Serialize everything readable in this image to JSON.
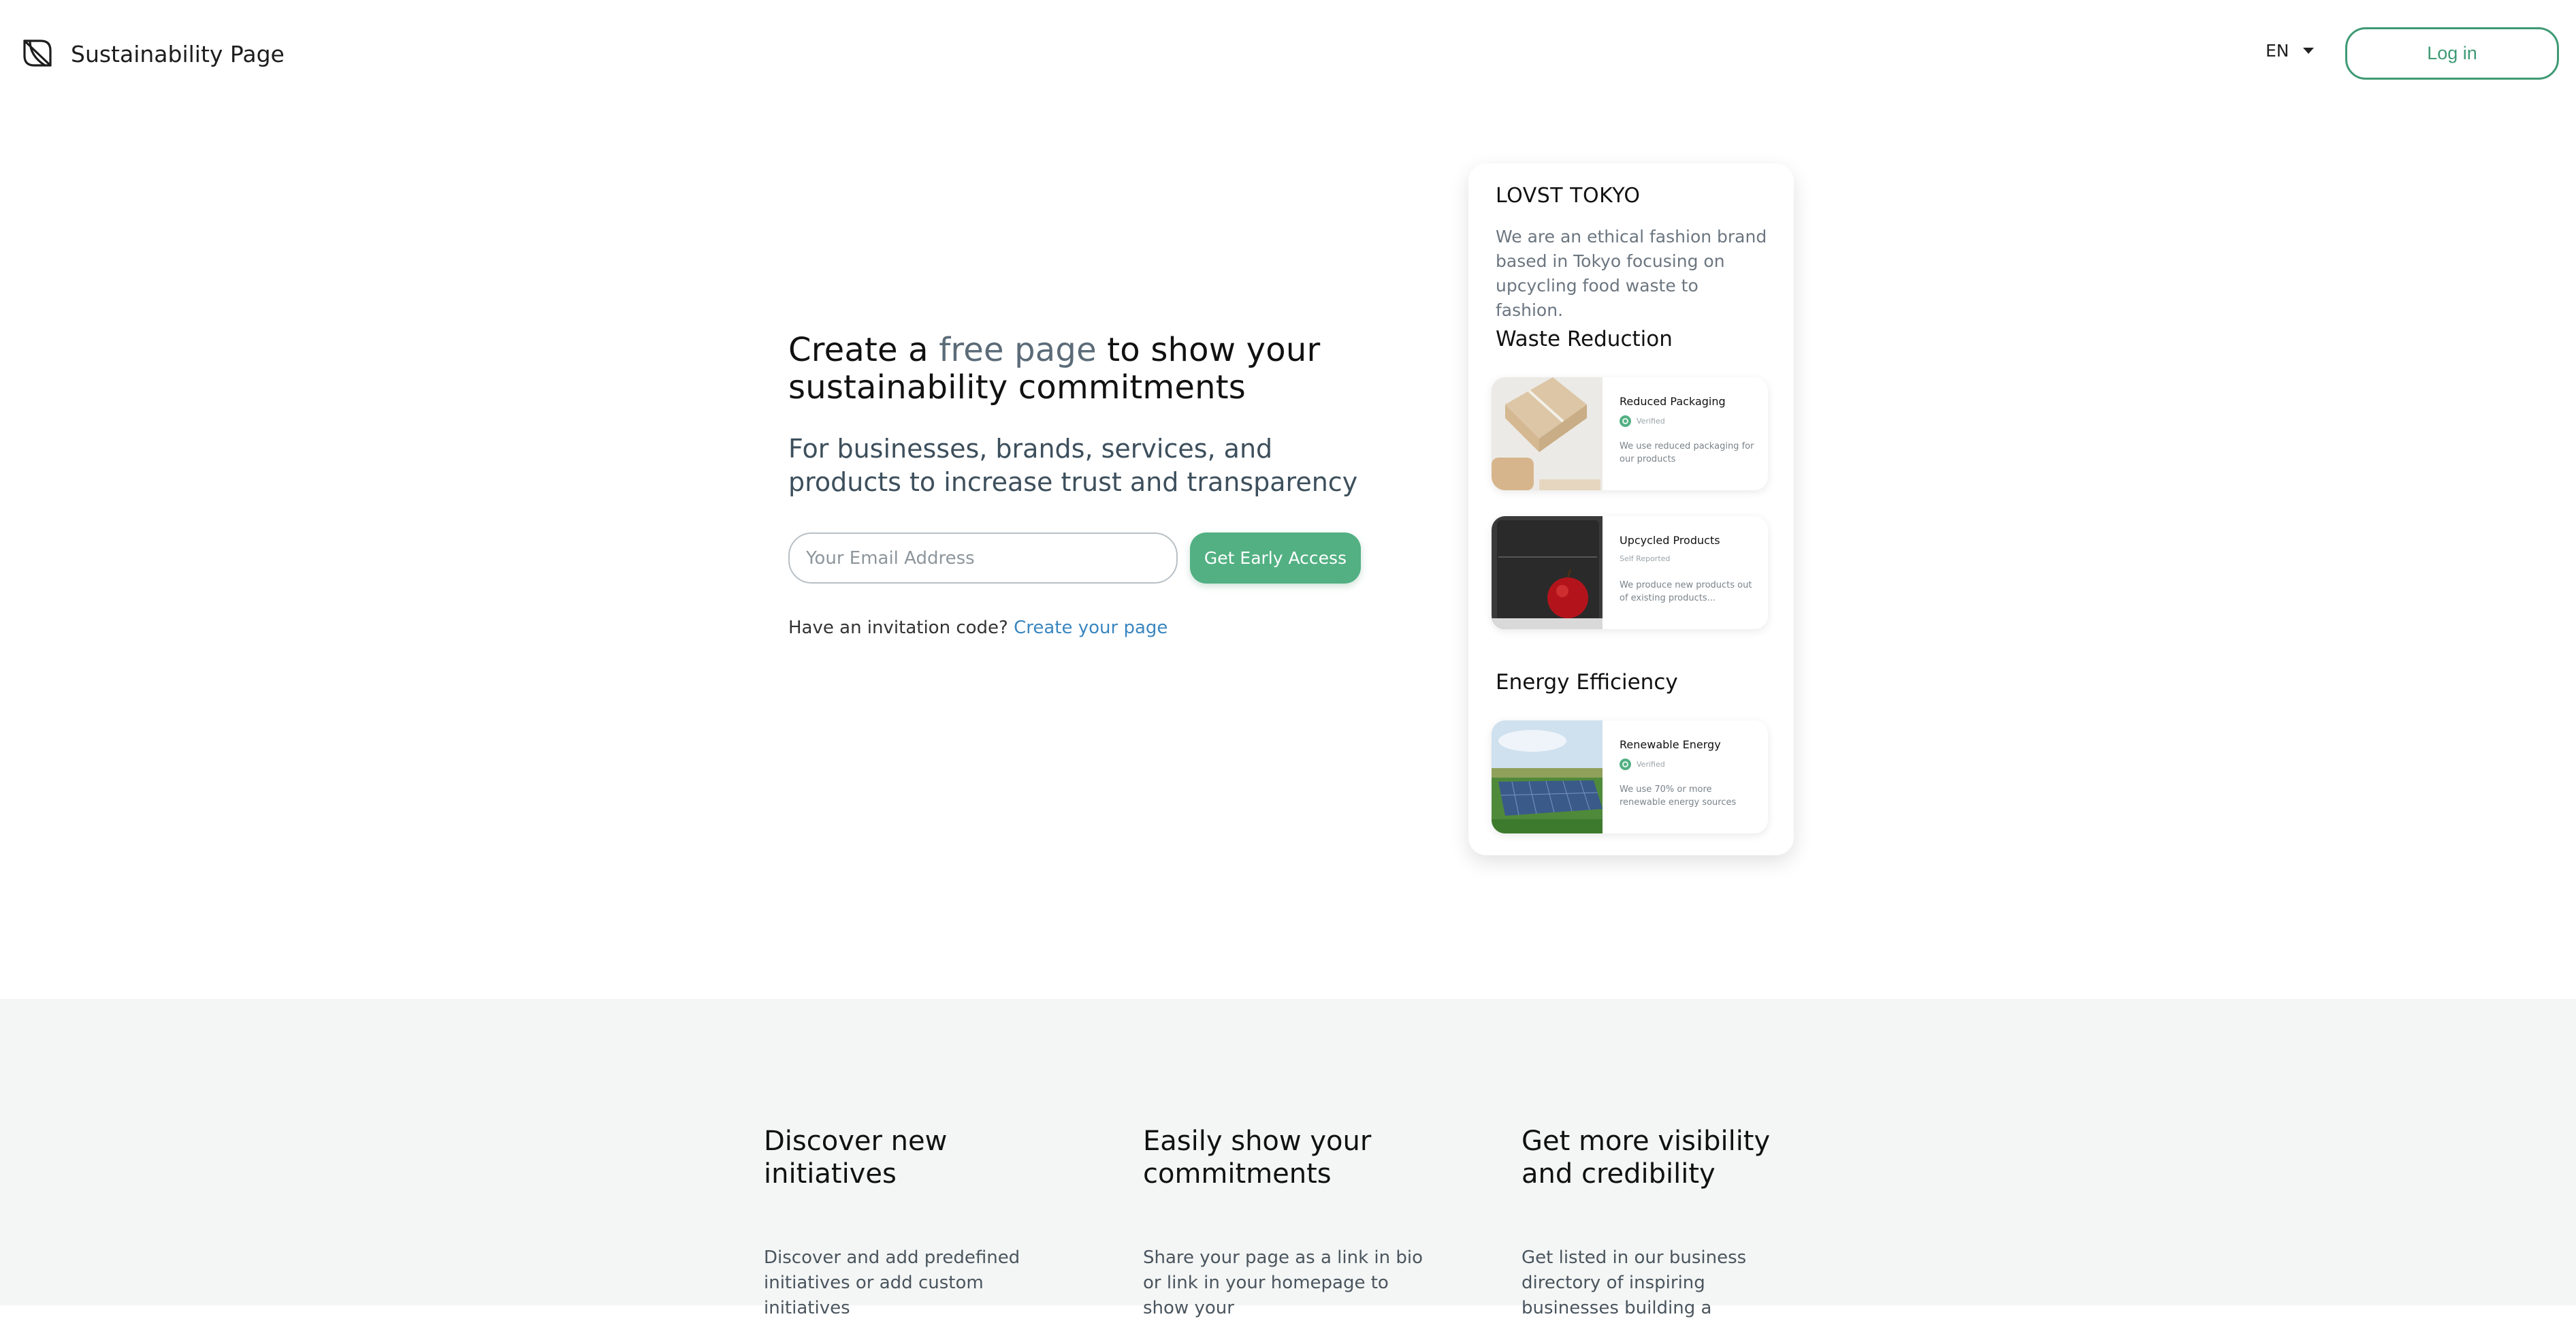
{
  "header": {
    "logo_text": "Sustainability Page",
    "language": "EN",
    "login_label": "Log in"
  },
  "hero": {
    "headline_before": "Create a ",
    "headline_highlight": "free page",
    "headline_after": " to show your sustainability commitments",
    "subheadline": "For businesses, brands, services, and products to increase trust and transparency",
    "email_placeholder": "Your Email Address",
    "cta_label": "Get Early Access",
    "invite_text": "Have an invitation code?",
    "invite_link": "Create your page"
  },
  "preview": {
    "brand_name": "LOVST TOKYO",
    "brand_description": "We are an ethical fashion brand based in Tokyo focusing on upcycling food waste to fashion.",
    "sections": [
      {
        "title": "Waste Reduction",
        "items": [
          {
            "title": "Reduced Packaging",
            "status": "Verified",
            "description": "We use reduced packaging for our products"
          },
          {
            "title": "Upcycled Products",
            "status": "Self Reported",
            "description": "We produce new products out of existing products..."
          }
        ]
      },
      {
        "title": "Energy Efficiency",
        "items": [
          {
            "title": "Renewable Energy",
            "status": "Verified",
            "description": "We use 70% or more renewable energy sources"
          }
        ]
      }
    ]
  },
  "features": [
    {
      "title": "Discover new initiatives",
      "description": "Discover and add predefined initiatives or add custom initiatives"
    },
    {
      "title": "Easily show your commitments",
      "description": "Share your page as a link in bio or link in your homepage to show your"
    },
    {
      "title": "Get more visibility and credibility",
      "description": "Get listed in our business directory of inspiring businesses building a"
    }
  ],
  "colors": {
    "accent": "#52b083",
    "login_border": "#3f9a74",
    "link": "#3a86c0",
    "features_bg": "#f4f6f5"
  }
}
